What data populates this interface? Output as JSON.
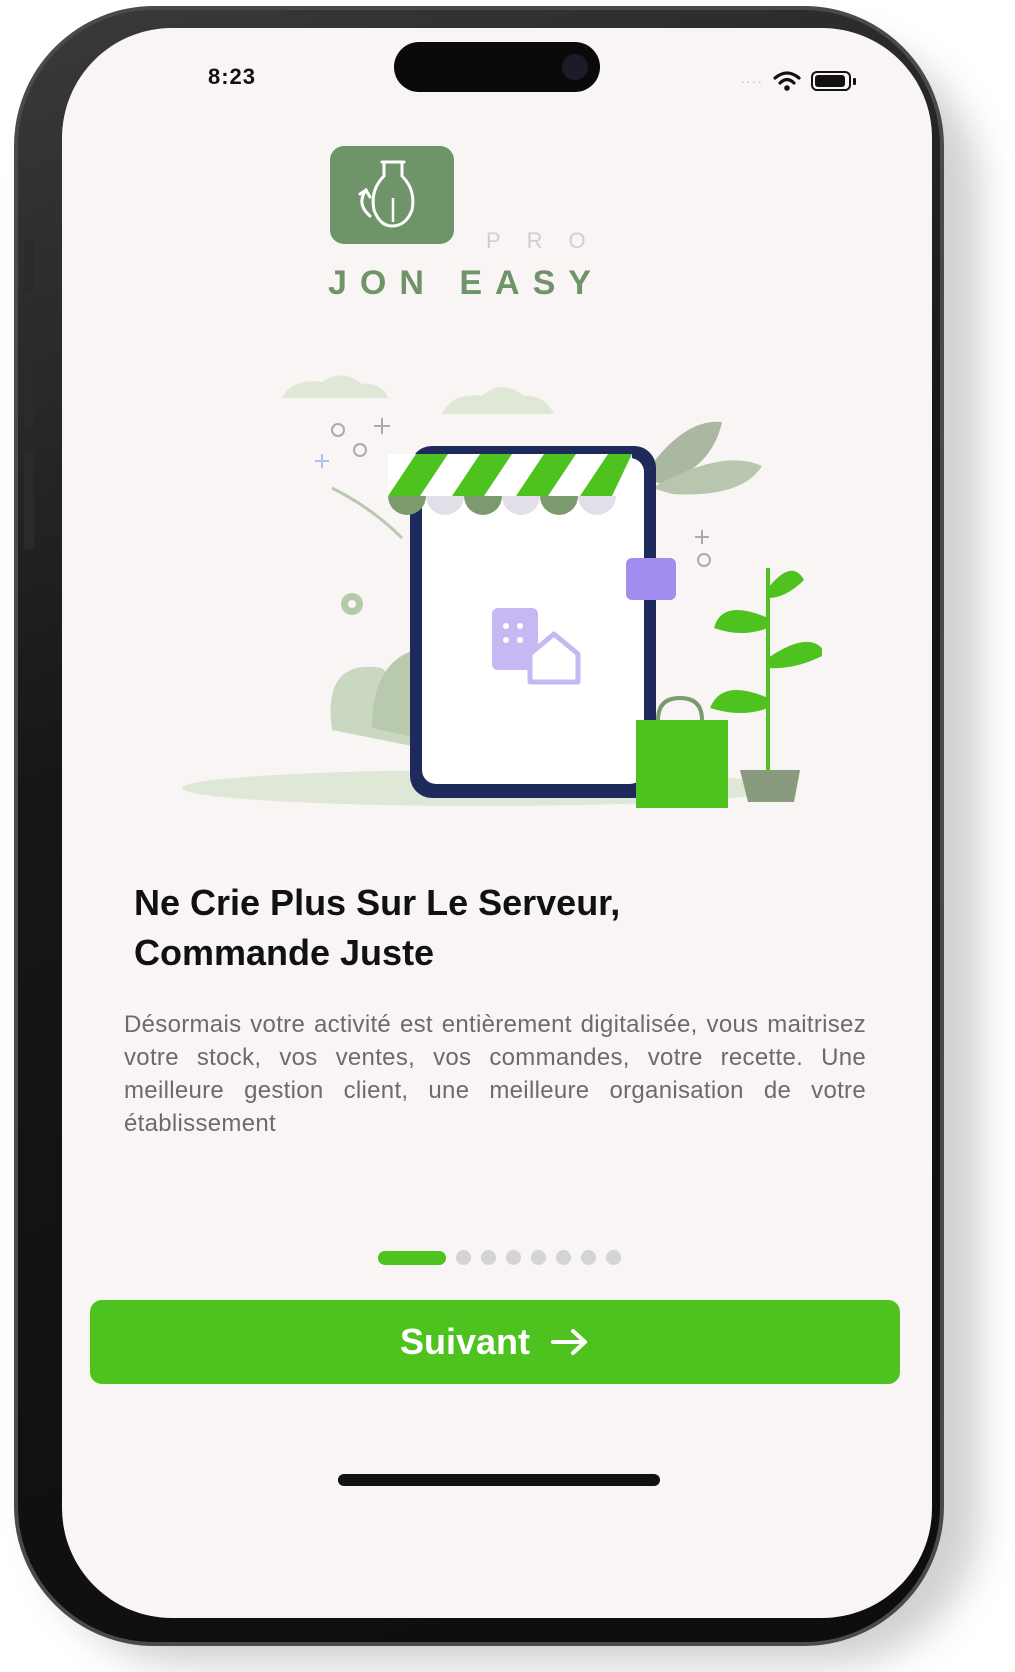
{
  "status_bar": {
    "time": "8:23",
    "signal": "····"
  },
  "brand": {
    "tag": "PRO",
    "name": "JON EASY"
  },
  "onboarding": {
    "headline_line1": "Ne Crie Plus Sur Le Serveur,",
    "headline_line2": "Commande Juste",
    "description": "Désormais votre activité est entièrement digitalisée, vous maitrisez votre stock, vos ventes, vos commandes, votre recette. Une meilleure gestion client, une meilleure organisation de votre établissement",
    "pager": {
      "total": 8,
      "current": 1
    },
    "next_label": "Suivant",
    "next_icon": "arrow-right-icon"
  },
  "colors": {
    "accent": "#4ec21e",
    "brand": "#6f946a",
    "background": "#f8f5f4",
    "navy": "#1e2a5c",
    "purple": "#a28cf0"
  }
}
